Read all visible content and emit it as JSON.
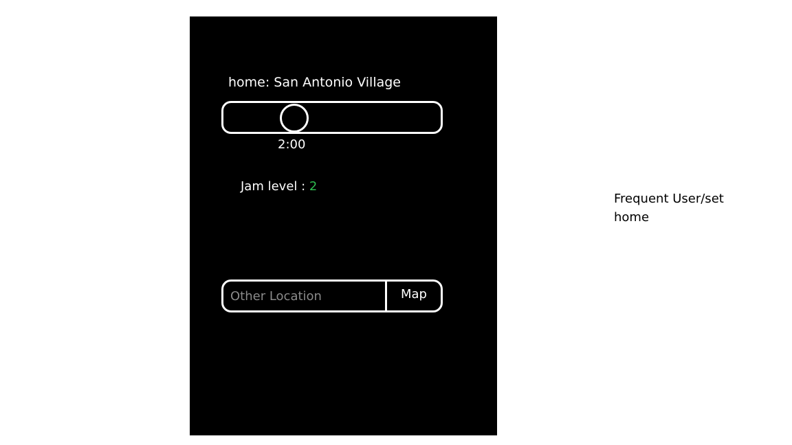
{
  "home": {
    "label": "home: San Antonio Village"
  },
  "time_slider": {
    "time_label": "2:00",
    "position_fraction": 0.3
  },
  "jam": {
    "label": "Jam level : ",
    "value": "2",
    "value_color": "#2ebd4f"
  },
  "location": {
    "placeholder": "Other Location",
    "map_button_label": "Map"
  },
  "annotation": {
    "text": "Frequent User/set home"
  }
}
